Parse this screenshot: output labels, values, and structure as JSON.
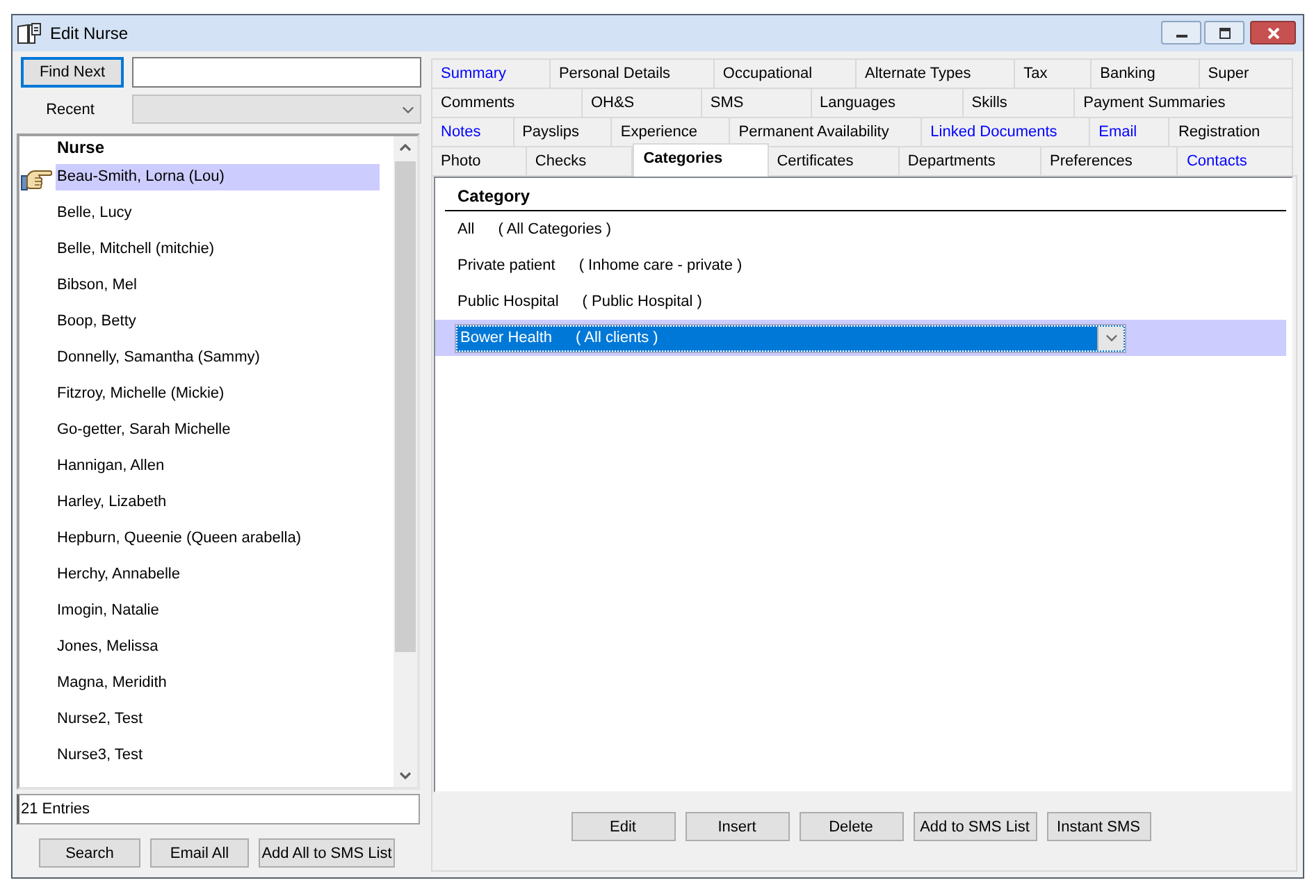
{
  "window": {
    "title": "Edit Nurse"
  },
  "find": {
    "button": "Find Next",
    "focused": true
  },
  "recent": {
    "label": "Recent",
    "disabled": true
  },
  "nurses": {
    "header": "Nurse",
    "items": [
      {
        "name": "Beau-Smith, Lorna (Lou)",
        "selected": true
      },
      {
        "name": "Belle, Lucy",
        "selected": false
      },
      {
        "name": "Belle, Mitchell (mitchie)",
        "selected": false
      },
      {
        "name": "Bibson, Mel",
        "selected": false
      },
      {
        "name": "Boop, Betty",
        "selected": false
      },
      {
        "name": "Donnelly, Samantha (Sammy)",
        "selected": false
      },
      {
        "name": "Fitzroy, Michelle (Mickie)",
        "selected": false
      },
      {
        "name": "Go-getter, Sarah Michelle",
        "selected": false
      },
      {
        "name": "Hannigan, Allen",
        "selected": false
      },
      {
        "name": "Harley, Lizabeth",
        "selected": false
      },
      {
        "name": "Hepburn, Queenie (Queen arabella)",
        "selected": false
      },
      {
        "name": "Herchy, Annabelle",
        "selected": false
      },
      {
        "name": "Imogin, Natalie",
        "selected": false
      },
      {
        "name": "Jones, Melissa",
        "selected": false
      },
      {
        "name": "Magna, Meridith",
        "selected": false
      },
      {
        "name": "Nurse2, Test",
        "selected": false
      },
      {
        "name": "Nurse3, Test",
        "selected": false
      }
    ],
    "count": "21 Entries"
  },
  "left_buttons": [
    "Search",
    "Email All",
    "Add All to SMS List"
  ],
  "tab_rows": [
    [
      {
        "label": "Summary",
        "selected": false,
        "highlighted": true
      },
      {
        "label": "Personal Details",
        "selected": false,
        "highlighted": false
      },
      {
        "label": "Occupational",
        "selected": false,
        "highlighted": false
      },
      {
        "label": "Alternate Types",
        "selected": false,
        "highlighted": false
      },
      {
        "label": "Tax",
        "selected": false,
        "highlighted": false
      },
      {
        "label": "Banking",
        "selected": false,
        "highlighted": false
      },
      {
        "label": "Super",
        "selected": false,
        "highlighted": false
      }
    ],
    [
      {
        "label": "Comments",
        "selected": false,
        "highlighted": false
      },
      {
        "label": "OH&S",
        "selected": false,
        "highlighted": false
      },
      {
        "label": "SMS",
        "selected": false,
        "highlighted": false
      },
      {
        "label": "Languages",
        "selected": false,
        "highlighted": false
      },
      {
        "label": "Skills",
        "selected": false,
        "highlighted": false
      },
      {
        "label": "Payment Summaries",
        "selected": false,
        "highlighted": false
      }
    ],
    [
      {
        "label": "Notes",
        "selected": false,
        "highlighted": true
      },
      {
        "label": "Payslips",
        "selected": false,
        "highlighted": false
      },
      {
        "label": "Experience",
        "selected": false,
        "highlighted": false
      },
      {
        "label": "Permanent Availability",
        "selected": false,
        "highlighted": false
      },
      {
        "label": "Linked Documents",
        "selected": false,
        "highlighted": true
      },
      {
        "label": "Email",
        "selected": false,
        "highlighted": true
      },
      {
        "label": "Registration",
        "selected": false,
        "highlighted": false
      }
    ],
    [
      {
        "label": "Photo",
        "selected": false,
        "highlighted": false
      },
      {
        "label": "Checks",
        "selected": false,
        "highlighted": false
      },
      {
        "label": "Categories",
        "selected": true,
        "highlighted": false
      },
      {
        "label": "Certificates",
        "selected": false,
        "highlighted": false
      },
      {
        "label": "Departments",
        "selected": false,
        "highlighted": false
      },
      {
        "label": "Preferences",
        "selected": false,
        "highlighted": false
      },
      {
        "label": "Contacts",
        "selected": false,
        "highlighted": true
      }
    ]
  ],
  "categories": {
    "header": "Category",
    "rows": [
      {
        "name": "All",
        "description": "( All Categories )",
        "selected": false
      },
      {
        "name": "Private patient",
        "description": "( Inhome care - private )",
        "selected": false
      },
      {
        "name": "Public Hospital",
        "description": "( Public Hospital )",
        "selected": false
      },
      {
        "name": "Bower Health",
        "description": "( All clients )",
        "selected": true
      }
    ]
  },
  "buttons": [
    "Edit",
    "Insert",
    "Delete",
    "Add to SMS List",
    "Instant SMS"
  ]
}
